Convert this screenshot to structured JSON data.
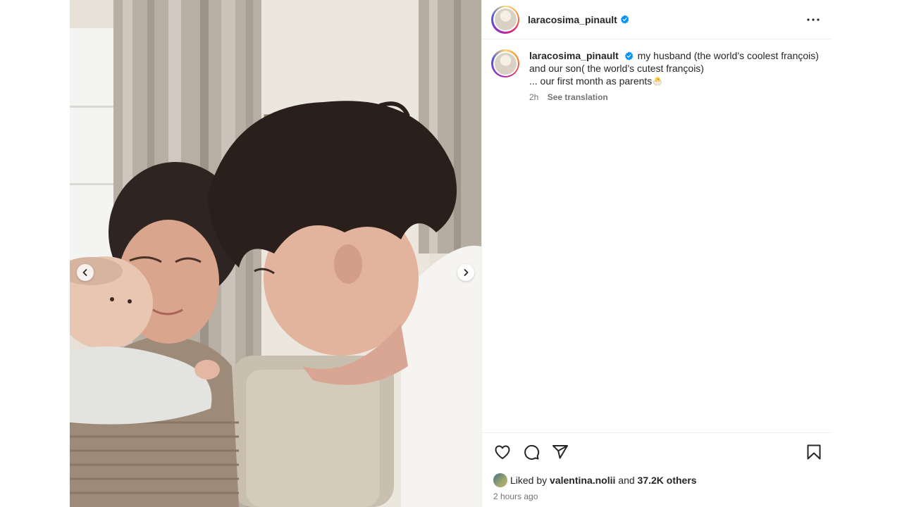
{
  "post": {
    "username": "laracosima_pinault",
    "verified": true,
    "caption": {
      "line1": "my husband (the world’s coolest françois)",
      "line2": "and our son( the world’s cutest françois)",
      "line3": "... our first month as parents",
      "emoji": "hatching-chick"
    },
    "caption_time": "2h",
    "see_translation": "See translation",
    "likes": {
      "prefix": "Liked by",
      "liker": "valentina.nolii",
      "connector": "and",
      "others": "37.2K others"
    },
    "timestamp": "2 hours ago"
  },
  "icons": {
    "more": "more-options-icon",
    "like": "heart-icon",
    "comment": "comment-icon",
    "share": "send-icon",
    "save": "bookmark-icon",
    "verified": "verified-badge-icon",
    "prev": "chevron-left-icon",
    "next": "chevron-right-icon"
  },
  "colors": {
    "verified_blue": "#0095f6",
    "text": "#262626",
    "secondary": "#737373",
    "divider": "#efefef"
  }
}
